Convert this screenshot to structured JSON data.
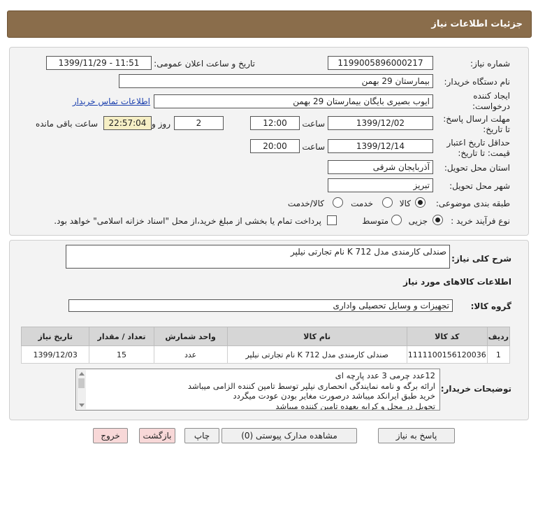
{
  "header": {
    "title": "جزئیات اطلاعات نیاز"
  },
  "form": {
    "need_number_label": "شماره نیاز:",
    "need_number": "1199005896000217",
    "announce_label": "تاریخ و ساعت اعلان عمومی:",
    "announce_value": "1399/11/29 - 11:51",
    "buyer_org_label": "نام دستگاه خریدار:",
    "buyer_org": "بیمارستان 29 بهمن",
    "creator_label_1": "ایجاد کننده",
    "creator_label_2": "درخواست:",
    "creator": "ایوب بصیری  بایگان بیمارستان 29 بهمن",
    "contact_link": "اطلاعات تماس خریدار",
    "reply_label_1": "مهلت ارسال پاسخ:",
    "reply_label_2": "تا تاریخ:",
    "reply_date": "1399/12/02",
    "time_label": "ساعت",
    "reply_time": "12:00",
    "days_value": "2",
    "days_label": "روز و",
    "remaining_time": "22:57:04",
    "remaining_label": "ساعت باقی مانده",
    "validity_label_1": "حداقل تاریخ اعتبار",
    "validity_label_2": "قیمت: تا تاریخ:",
    "validity_date": "1399/12/14",
    "validity_time": "20:00",
    "province_label": "استان محل تحویل:",
    "province": "آذربایجان شرقی",
    "city_label": "شهر محل تحویل:",
    "city": "تبریز",
    "category_label": "طبقه بندی موضوعی:",
    "category_options": [
      "کالا",
      "خدمت",
      "کالا/خدمت"
    ],
    "category_selected": "کالا",
    "process_label": "نوع فرآیند خرید :",
    "process_options": [
      "جزیی",
      "متوسط"
    ],
    "process_selected": "جزیی",
    "payment_note": "پرداخت تمام یا بخشی از مبلغ خرید،از محل \"اسناد خزانه اسلامی\" خواهد بود."
  },
  "summary": {
    "general_desc_label": "شرح کلی نیاز:",
    "general_desc": "صندلی کارمندی مدل K 712 نام تجارتی نیلپر",
    "goods_info_title": "اطلاعات کالاهای مورد نیاز",
    "goods_group_label": "گروه کالا:",
    "goods_group": "تجهیزات و وسایل تحصیلی واداری"
  },
  "table": {
    "headers": [
      "ردیف",
      "کد کالا",
      "نام کالا",
      "واحد شمارش",
      "تعداد / مقدار",
      "تاریخ نیاز"
    ],
    "rows": [
      [
        "1",
        "1111100156120036",
        "صندلی کارمندی مدل K 712 نام تجارتی نیلپر",
        "عدد",
        "15",
        "1399/12/03"
      ]
    ]
  },
  "notes": {
    "label": "توضیحات خریدار:",
    "lines": [
      "12عدد چرمی 3 عدد پارچه ای",
      "ارائه برگه و نامه نمایندگی انحصاری نیلپر توسط تامین کننده الزامی میباشد",
      "خرید طبق ایرانکد میباشد درصورت مغایر بودن عودت میگردد",
      "تحویل در محل و کرایه بعهده تامین کننده میباشد"
    ]
  },
  "buttons": {
    "reply": "پاسخ به نیاز",
    "attachments": "مشاهده مدارک پیوستی (0)",
    "print": "چاپ",
    "back": "بازگشت",
    "exit": "خروج"
  }
}
